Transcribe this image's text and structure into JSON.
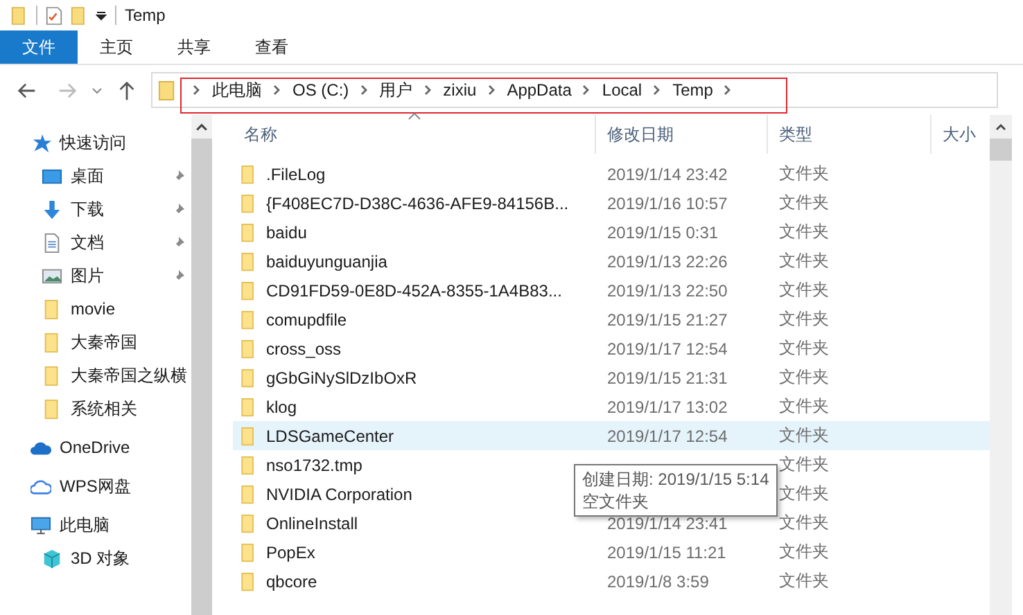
{
  "window": {
    "title": "Temp"
  },
  "ribbon_tabs": [
    {
      "label": "文件",
      "selected": true
    },
    {
      "label": "主页",
      "selected": false
    },
    {
      "label": "共享",
      "selected": false
    },
    {
      "label": "查看",
      "selected": false
    }
  ],
  "breadcrumb": [
    "此电脑",
    "OS (C:)",
    "用户",
    "zixiu",
    "AppData",
    "Local",
    "Temp"
  ],
  "sidebar": {
    "items": [
      {
        "label": "快速访问",
        "kind": "star",
        "children": [
          {
            "label": "桌面",
            "kind": "desktop",
            "pinned": true
          },
          {
            "label": "下载",
            "kind": "download",
            "pinned": true
          },
          {
            "label": "文档",
            "kind": "document",
            "pinned": true
          },
          {
            "label": "图片",
            "kind": "image",
            "pinned": true
          },
          {
            "label": "movie",
            "kind": "folder",
            "pinned": false
          },
          {
            "label": "大秦帝国",
            "kind": "folder",
            "pinned": false
          },
          {
            "label": "大秦帝国之纵横",
            "kind": "folder",
            "pinned": false
          },
          {
            "label": "系统相关",
            "kind": "folder",
            "pinned": false
          }
        ]
      },
      {
        "label": "OneDrive",
        "kind": "cloud"
      },
      {
        "label": "WPS网盘",
        "kind": "cloud-outline"
      },
      {
        "label": "此电脑",
        "kind": "pc",
        "children": [
          {
            "label": "3D 对象",
            "kind": "cube",
            "pinned": false
          }
        ]
      }
    ]
  },
  "table": {
    "columns": [
      "名称",
      "修改日期",
      "类型",
      "大小"
    ],
    "rows": [
      {
        "name": ".FileLog",
        "modified": "2019/1/14 23:42",
        "type": "文件夹",
        "highlighted": false
      },
      {
        "name": "{F408EC7D-D38C-4636-AFE9-84156B...",
        "modified": "2019/1/16 10:57",
        "type": "文件夹",
        "highlighted": false
      },
      {
        "name": "baidu",
        "modified": "2019/1/15 0:31",
        "type": "文件夹",
        "highlighted": false
      },
      {
        "name": "baiduyunguanjia",
        "modified": "2019/1/13 22:26",
        "type": "文件夹",
        "highlighted": false
      },
      {
        "name": "CD91FD59-0E8D-452A-8355-1A4B83...",
        "modified": "2019/1/13 22:50",
        "type": "文件夹",
        "highlighted": false
      },
      {
        "name": "comupdfile",
        "modified": "2019/1/15 21:27",
        "type": "文件夹",
        "highlighted": false
      },
      {
        "name": "cross_oss",
        "modified": "2019/1/17 12:54",
        "type": "文件夹",
        "highlighted": false
      },
      {
        "name": "gGbGiNySlDzIbOxR",
        "modified": "2019/1/15 21:31",
        "type": "文件夹",
        "highlighted": false
      },
      {
        "name": "klog",
        "modified": "2019/1/17 13:02",
        "type": "文件夹",
        "highlighted": false
      },
      {
        "name": "LDSGameCenter",
        "modified": "2019/1/17 12:54",
        "type": "文件夹",
        "highlighted": true
      },
      {
        "name": "nso1732.tmp",
        "type": "文件夹",
        "highlighted": false
      },
      {
        "name": "NVIDIA Corporation",
        "type": "文件夹",
        "highlighted": false
      },
      {
        "name": "OnlineInstall",
        "modified": "2019/1/14 23:41",
        "type": "文件夹",
        "highlighted": false
      },
      {
        "name": "PopEx",
        "modified": "2019/1/15 11:21",
        "type": "文件夹",
        "highlighted": false
      },
      {
        "name": "qbcore",
        "modified": "2019/1/8 3:59",
        "type": "文件夹",
        "highlighted": false
      }
    ]
  },
  "tooltip": {
    "lines": [
      "创建日期: 2019/1/15 5:14",
      "空文件夹"
    ]
  }
}
